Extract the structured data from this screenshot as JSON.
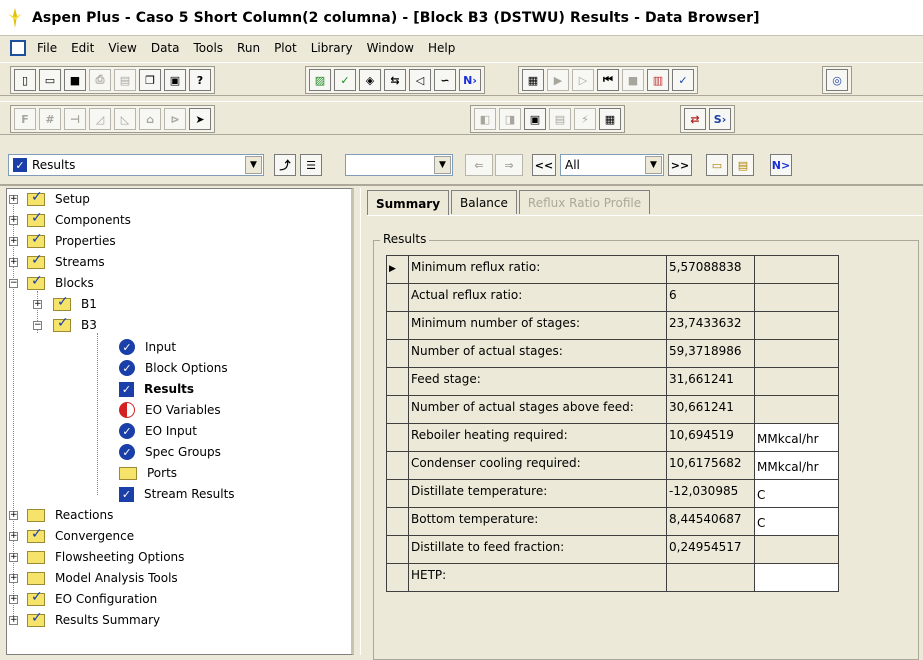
{
  "window": {
    "title": "Aspen Plus - Caso 5 Short Column(2 columna) - [Block B3 (DSTWU) Results - Data Browser]"
  },
  "menu": [
    "File",
    "Edit",
    "View",
    "Data",
    "Tools",
    "Run",
    "Plot",
    "Library",
    "Window",
    "Help"
  ],
  "nav": {
    "form_selector": "Results",
    "filter": "All",
    "prev_label": "<<",
    "next_label": ">>",
    "n_label": "N>"
  },
  "tree": [
    {
      "label": "Setup"
    },
    {
      "label": "Components"
    },
    {
      "label": "Properties"
    },
    {
      "label": "Streams"
    },
    {
      "label": "Blocks"
    },
    {
      "label": "B1"
    },
    {
      "label": "B3"
    },
    {
      "label": "Input"
    },
    {
      "label": "Block Options"
    },
    {
      "label": "Results"
    },
    {
      "label": "EO Variables"
    },
    {
      "label": "EO Input"
    },
    {
      "label": "Spec Groups"
    },
    {
      "label": "Ports"
    },
    {
      "label": "Stream Results"
    },
    {
      "label": "Reactions"
    },
    {
      "label": "Convergence"
    },
    {
      "label": "Flowsheeting Options"
    },
    {
      "label": "Model Analysis Tools"
    },
    {
      "label": "EO Configuration"
    },
    {
      "label": "Results Summary"
    }
  ],
  "tabs": [
    {
      "label": "Summary"
    },
    {
      "label": "Balance"
    },
    {
      "label": "Reflux Ratio Profile"
    }
  ],
  "results": {
    "group_label": "Results",
    "rows": [
      {
        "label": "Minimum reflux ratio:",
        "value": "5,57088838",
        "unit": ""
      },
      {
        "label": "Actual reflux ratio:",
        "value": "6",
        "unit": ""
      },
      {
        "label": "Minimum number of stages:",
        "value": "23,7433632",
        "unit": ""
      },
      {
        "label": "Number of actual stages:",
        "value": "59,3718986",
        "unit": ""
      },
      {
        "label": "Feed stage:",
        "value": "31,661241",
        "unit": ""
      },
      {
        "label": "Number of actual stages above feed:",
        "value": "30,661241",
        "unit": ""
      },
      {
        "label": "Reboiler heating required:",
        "value": "10,694519",
        "unit": "MMkcal/hr"
      },
      {
        "label": "Condenser cooling required:",
        "value": "10,6175682",
        "unit": "MMkcal/hr"
      },
      {
        "label": "Distillate temperature:",
        "value": "-12,030985",
        "unit": "C"
      },
      {
        "label": "Bottom temperature:",
        "value": "8,44540687",
        "unit": "C"
      },
      {
        "label": "Distillate to feed fraction:",
        "value": "0,24954517",
        "unit": ""
      },
      {
        "label": "HETP:",
        "value": "",
        "unit": ""
      }
    ]
  }
}
